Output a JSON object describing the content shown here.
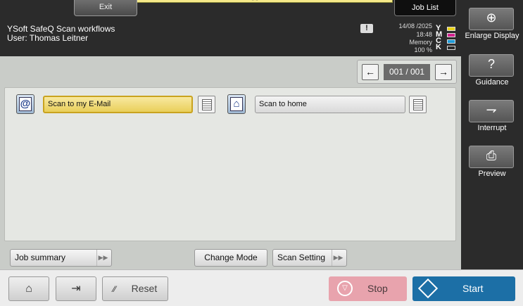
{
  "top": {
    "exit_label": "Exit",
    "job_list_label": "Job List",
    "grip_glyph": "«•»"
  },
  "header": {
    "workflow_title": "YSoft SafeQ Scan workflows",
    "user_line": "User: Thomas Leitner",
    "warning_glyph": "!",
    "date": "14/08 /2025",
    "time": "18:48",
    "memory_label": "Memory",
    "memory_value": "100 %",
    "toner": [
      {
        "letter": "Y",
        "color": "#e8d21a"
      },
      {
        "letter": "M",
        "color": "#d4228f"
      },
      {
        "letter": "C",
        "color": "#1f9ad6"
      },
      {
        "letter": "K",
        "color": "#2b2b2b"
      }
    ]
  },
  "sidebar": {
    "enlarge_label": "Enlarge Display",
    "guidance_label": "Guidance",
    "interrupt_label": "Interrupt",
    "preview_label": "Preview",
    "enlarge_icon": "⊕",
    "guidance_icon": "?",
    "interrupt_icon": "⇁",
    "preview_icon": "⎙"
  },
  "pager": {
    "prev_glyph": "←",
    "next_glyph": "→",
    "page_text": "001 /  001"
  },
  "workflows": [
    {
      "label": "Scan to my E-Mail",
      "icon": "@",
      "selected": true
    },
    {
      "label": "Scan to home",
      "icon": "⌂",
      "selected": false
    }
  ],
  "bottom_bar": {
    "job_summary_label": "Job summary",
    "change_mode_label": "Change Mode",
    "scan_setting_label": "Scan Setting",
    "arrows_glyph": "▶▶"
  },
  "footer": {
    "home_glyph": "⌂",
    "logout_glyph": "⇥",
    "reset_glyph": "⁄⁄",
    "reset_label": "Reset",
    "stop_glyph": "▽",
    "stop_label": "Stop",
    "start_glyph": "◇",
    "start_label": "Start"
  }
}
